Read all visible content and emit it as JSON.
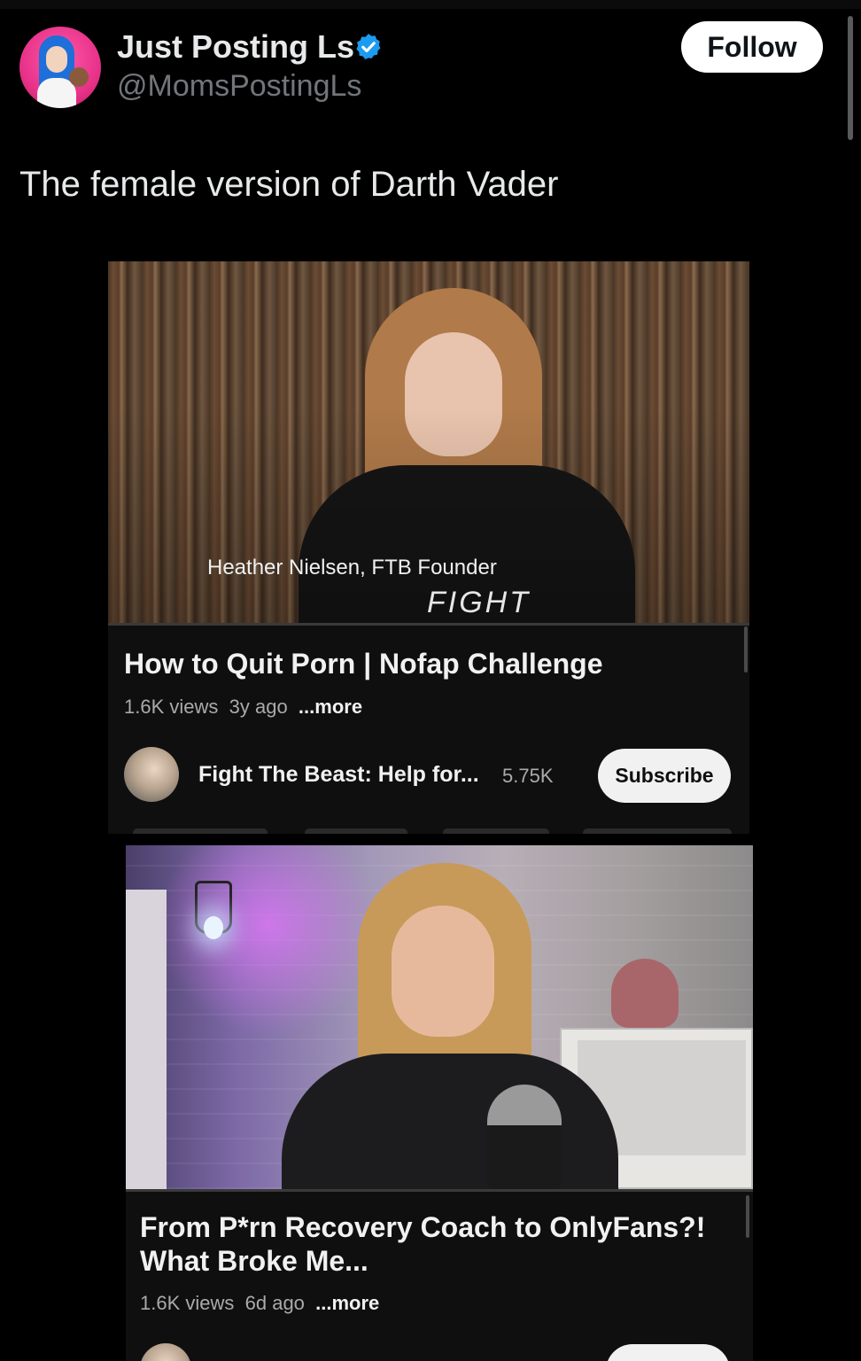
{
  "post": {
    "display_name": "Just Posting Ls",
    "handle": "@MomsPostingLs",
    "follow_label": "Follow",
    "text": "The female version of Darth Vader",
    "verified_icon": "verified-badge-icon",
    "accent_color": "#1d9bf0"
  },
  "videos": [
    {
      "overlay_caption": "Heather Nielsen, FTB Founder",
      "overlay_logo": "FIGHT",
      "title": "How to Quit Porn | Nofap Challenge",
      "views": "1.6K views",
      "age": "3y ago",
      "more_label": "...more",
      "channel_name": "Fight The Beast: Help for...",
      "subscribers": "5.75K",
      "subscribe_label": "Subscribe"
    },
    {
      "title": "From P*rn Recovery Coach to OnlyFans?! What Broke Me...",
      "views": "1.6K views",
      "age": "6d ago",
      "more_label": "...more"
    }
  ]
}
